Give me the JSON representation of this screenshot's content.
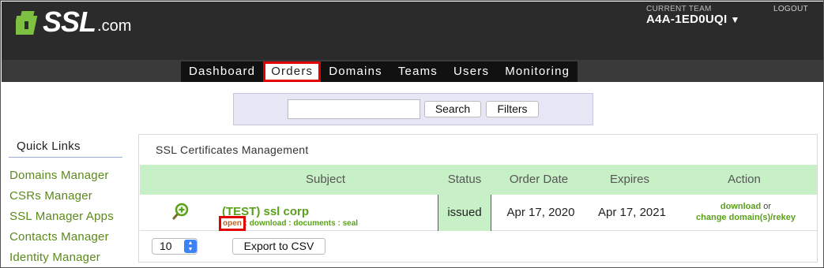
{
  "header": {
    "logo_text": "SSL",
    "logo_suffix": ".com",
    "current_team_label": "CURRENT TEAM",
    "current_team_value": "A4A-1ED0UQI",
    "logout": "LOGOUT"
  },
  "nav": {
    "items": [
      {
        "label": "Dashboard"
      },
      {
        "label": "Orders",
        "active": true
      },
      {
        "label": "Domains"
      },
      {
        "label": "Teams"
      },
      {
        "label": "Users"
      },
      {
        "label": "Monitoring"
      }
    ]
  },
  "search": {
    "value": "",
    "search_button": "Search",
    "filters_button": "Filters"
  },
  "quick_links": {
    "title": "Quick Links",
    "items": [
      "Domains Manager",
      "CSRs Manager",
      "SSL Manager Apps",
      "Contacts Manager",
      "Identity Manager"
    ]
  },
  "panel": {
    "title": "SSL Certificates Management",
    "columns": {
      "subject": "Subject",
      "status": "Status",
      "order_date": "Order Date",
      "expires": "Expires",
      "action": "Action"
    },
    "rows": [
      {
        "subject": "(TEST) ssl corp",
        "links": {
          "open": "open",
          "download": "download",
          "documents": "documents",
          "seal": "seal"
        },
        "status": "issued",
        "order_date": "Apr 17, 2020",
        "expires": "Apr 17, 2021",
        "action_download": "download",
        "action_or": "or",
        "action_change": "change domain(s)/rekey"
      }
    ],
    "per_page": "10",
    "export_button": "Export to CSV"
  },
  "colors": {
    "accent_green": "#5aa01a",
    "header_bg": "#2b2b2b",
    "highlight_red": "#e00000",
    "table_header_bg": "#c7f0c7"
  }
}
